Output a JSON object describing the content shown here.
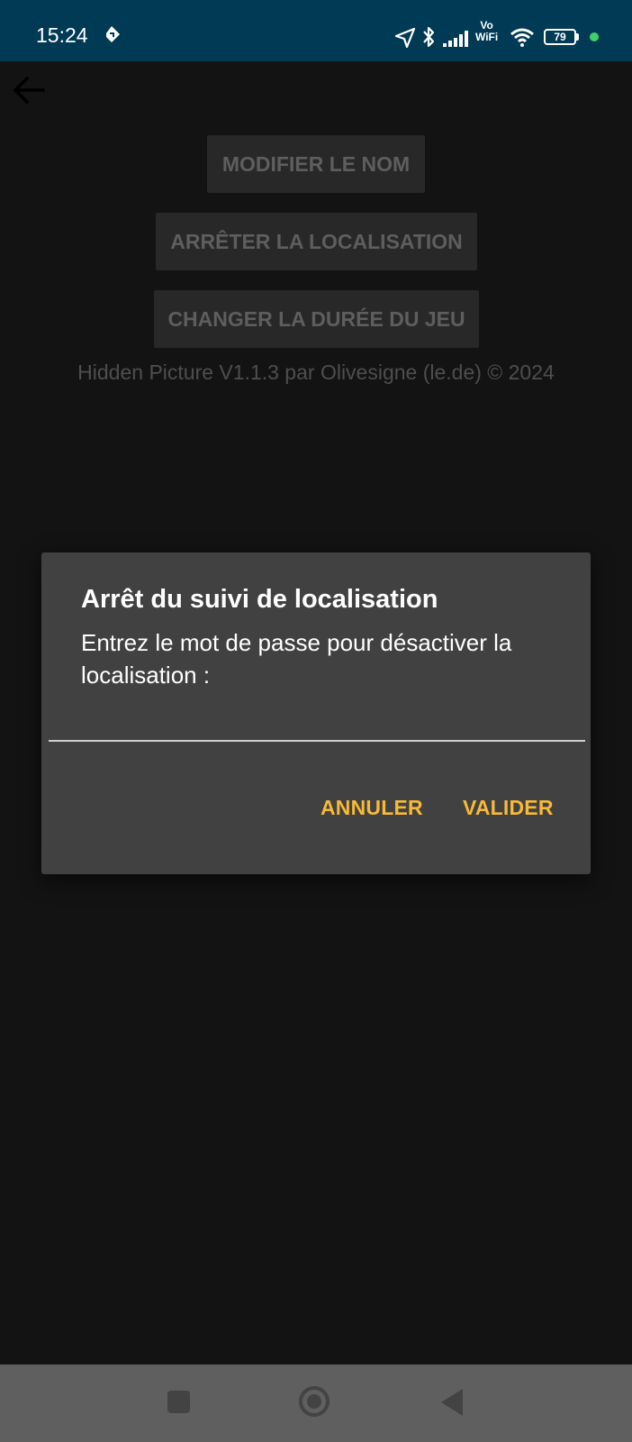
{
  "status_bar": {
    "time": "15:24",
    "vowifi_line1": "Vo",
    "vowifi_line2": "WiFi",
    "battery": "79"
  },
  "app": {
    "buttons": {
      "rename": "MODIFIER LE NOM",
      "stop_location": "ARRÊTER LA LOCALISATION",
      "change_duration": "CHANGER LA DURÉE DU JEU"
    },
    "footer": "Hidden Picture V1.1.3 par Olivesigne (le.de) © 2024"
  },
  "dialog": {
    "title": "Arrêt du suivi de localisation",
    "message": "Entrez le mot de passe pour désactiver la localisation :",
    "input_value": "",
    "cancel_label": "ANNULER",
    "validate_label": "VALIDER"
  },
  "colors": {
    "status_bar": "#003a55",
    "accent": "#f6b93a",
    "background": "#131313",
    "dialog": "#414141"
  }
}
